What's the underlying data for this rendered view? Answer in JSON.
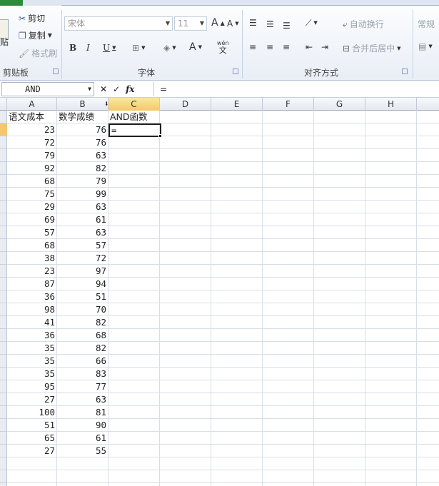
{
  "ribbon": {
    "clipboard": {
      "paste_partial": "贴",
      "cut": "剪切",
      "copy": "复制",
      "format_painter": "格式刷",
      "label": "剪贴板"
    },
    "font": {
      "font_name": "宋体",
      "font_size": "11",
      "bold": "B",
      "italic": "I",
      "underline": "U",
      "label": "字体",
      "grow": "A",
      "shrink": "A",
      "font_color": "A",
      "wen": "wén",
      "wen_char": "文"
    },
    "alignment": {
      "wrap_text": "自动换行",
      "merge_center": "合并后居中",
      "label": "对齐方式"
    },
    "number": {
      "format": "常规"
    }
  },
  "formula_bar": {
    "name_box": "AND",
    "fx": "fx",
    "formula": "="
  },
  "columns": [
    "A",
    "B",
    "C",
    "D",
    "E",
    "F",
    "G",
    "H"
  ],
  "headers": {
    "A": "语文成本",
    "B": "数学成绩",
    "C": "AND函数"
  },
  "rows": [
    [
      23,
      76
    ],
    [
      72,
      76
    ],
    [
      79,
      63
    ],
    [
      92,
      82
    ],
    [
      68,
      79
    ],
    [
      75,
      99
    ],
    [
      29,
      63
    ],
    [
      69,
      61
    ],
    [
      57,
      63
    ],
    [
      68,
      57
    ],
    [
      38,
      72
    ],
    [
      23,
      97
    ],
    [
      87,
      94
    ],
    [
      36,
      51
    ],
    [
      98,
      70
    ],
    [
      41,
      82
    ],
    [
      36,
      68
    ],
    [
      35,
      82
    ],
    [
      35,
      66
    ],
    [
      35,
      83
    ],
    [
      95,
      77
    ],
    [
      27,
      63
    ],
    [
      100,
      81
    ],
    [
      51,
      90
    ],
    [
      65,
      61
    ],
    [
      27,
      55
    ]
  ],
  "active_cell": {
    "ref": "C2",
    "value": "="
  },
  "colors": {
    "selected_header": "#f4c76a",
    "file_tab": "#2d8a3b"
  }
}
